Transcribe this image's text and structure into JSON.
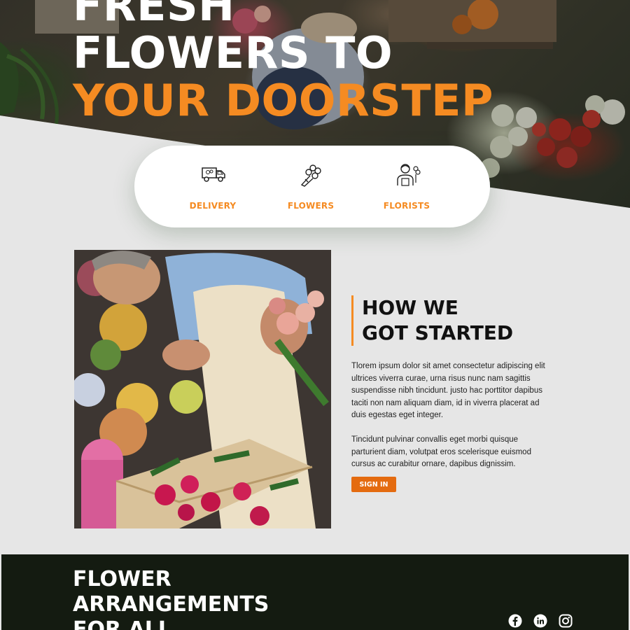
{
  "hero": {
    "title_line1": "FRESH",
    "title_line2": "FLOWERS TO",
    "title_line3": "YOUR DOORSTEP"
  },
  "features": [
    {
      "label": "DELIVERY",
      "icon": "delivery-van-icon"
    },
    {
      "label": "FLOWERS",
      "icon": "bouquet-icon"
    },
    {
      "label": "FLORISTS",
      "icon": "florist-icon"
    }
  ],
  "story": {
    "heading_line1": "HOW WE",
    "heading_line2": "GOT STARTED",
    "paragraph1": "Tlorem ipsum dolor sit amet consectetur adipiscing elit ultrices viverra curae, urna risus nunc nam sagittis suspendisse nibh tincidunt. justo hac porttitor dapibus taciti non nam aliquam diam, id in viverra placerat ad duis egestas eget integer.",
    "paragraph2": "Tincidunt pulvinar convallis eget morbi quisque parturient diam, volutpat eros scelerisque euismod cursus ac curabitur ornare, dapibus dignissim.",
    "button_label": "SIGN IN",
    "photo_icon": "florist-arranging-roses-photo"
  },
  "footer": {
    "title_line1": "FLOWER",
    "title_line2": "ARRANGEMENTS",
    "title_line3": "FOR ALL",
    "social": [
      "facebook-icon",
      "linkedin-icon",
      "instagram-icon"
    ]
  },
  "colors": {
    "accent": "#f58b22",
    "button": "#e46b10",
    "footer_bg": "#141b11",
    "page_bg": "#e6e6e6"
  }
}
